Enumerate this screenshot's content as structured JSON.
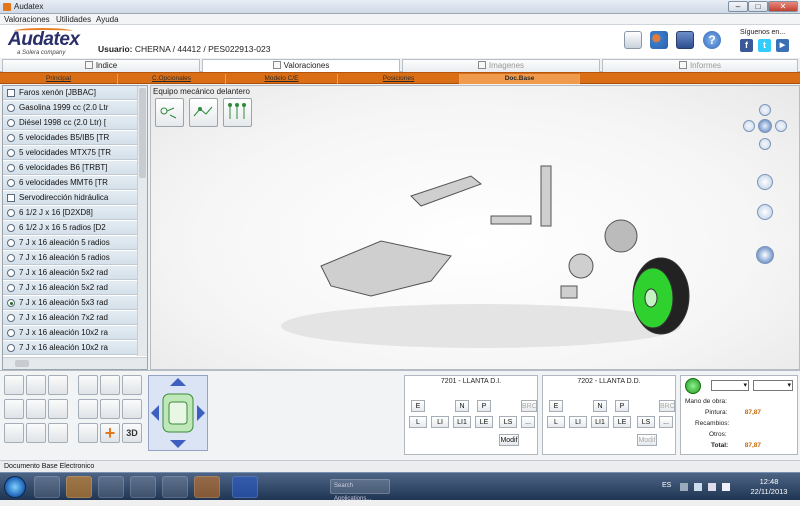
{
  "window": {
    "title": "Audatex",
    "controls": {
      "minimize": "–",
      "maximize": "□",
      "close": "✕"
    }
  },
  "menu": [
    "Valoraciones",
    "Utilidades",
    "Ayuda"
  ],
  "header": {
    "logo": "Audatex",
    "tagline": "a Solera company",
    "user_label": "Usuario:",
    "user_value": "CHERNA / 44412 / PES022913-023",
    "follow_label": "Síguenos en...",
    "icons": [
      "car-tool-icon",
      "users-icon",
      "monitor-icon",
      "help-icon"
    ],
    "social": [
      {
        "name": "facebook",
        "glyph": "f",
        "color": "#3b5998"
      },
      {
        "name": "twitter",
        "glyph": "t",
        "color": "#33ccff"
      },
      {
        "name": "youtube",
        "glyph": "▶",
        "color": "#3b6fb6"
      }
    ]
  },
  "tabs": [
    {
      "label": "Indice",
      "state": "normal"
    },
    {
      "label": "Valoraciones",
      "state": "active"
    },
    {
      "label": "Imagenes",
      "state": "disabled"
    },
    {
      "label": "Informes",
      "state": "disabled"
    }
  ],
  "subtabs": [
    {
      "label": "Principal",
      "active": false
    },
    {
      "label": "C.Opcionales",
      "active": false
    },
    {
      "label": "Modelo C/E",
      "active": false
    },
    {
      "label": "Posiciones",
      "active": false
    },
    {
      "label": "Doc.Base",
      "active": true
    }
  ],
  "options_list": [
    {
      "type": "checkbox",
      "checked": false,
      "label": "Faros xenón  [JBBAC]"
    },
    {
      "type": "radio",
      "checked": false,
      "label": "Gasolina 1999 cc (2.0 Ltr"
    },
    {
      "type": "radio",
      "checked": false,
      "label": "Diésel 1998 cc (2.0 Ltr)  ["
    },
    {
      "type": "radio",
      "checked": false,
      "label": "5 velocidades B5/IB5  [TR"
    },
    {
      "type": "radio",
      "checked": false,
      "label": "5 velocidades MTX75  [TR"
    },
    {
      "type": "radio",
      "checked": false,
      "label": "6 velocidades B6  [TRBT]"
    },
    {
      "type": "radio",
      "checked": false,
      "label": "6 velocidades MMT6  [TR"
    },
    {
      "type": "checkbox",
      "checked": false,
      "label": "Servodirección hidráulica"
    },
    {
      "type": "radio",
      "checked": false,
      "label": "6 1/2 J x 16  [D2XD8]"
    },
    {
      "type": "radio",
      "checked": false,
      "label": "6 1/2 J x 16 5 radios  [D2"
    },
    {
      "type": "radio",
      "checked": false,
      "label": "7 J x 16 aleación 5 radios"
    },
    {
      "type": "radio",
      "checked": false,
      "label": "7 J x 16 aleación 5 radios"
    },
    {
      "type": "radio",
      "checked": false,
      "label": "7 J x 16 aleación 5x2 rad"
    },
    {
      "type": "radio",
      "checked": false,
      "label": "7 J x 16 aleación 5x2 rad"
    },
    {
      "type": "radio",
      "checked": true,
      "label": "7 J x 16 aleación 5x3 rad"
    },
    {
      "type": "radio",
      "checked": false,
      "label": "7 J x 16 aleación 7x2 rad"
    },
    {
      "type": "radio",
      "checked": false,
      "label": "7 J x 16 aleación 10x2 ra"
    },
    {
      "type": "radio",
      "checked": false,
      "label": "7 J x 16 aleación 10x2 ra"
    }
  ],
  "viewer": {
    "title": "Equipo mecánico delantero"
  },
  "ladders": [
    {
      "title": "7201 - LLANTA D.I.",
      "ops_row1": [
        "E",
        "N",
        "P",
        "BRC"
      ],
      "ops_row2": [
        "L",
        "LI",
        "LI1",
        "LE",
        "LS",
        "..."
      ],
      "modif": "Modif"
    },
    {
      "title": "7202 - LLANTA D.D.",
      "ops_row1": [
        "E",
        "N",
        "P",
        "BRC"
      ],
      "ops_row2": [
        "L",
        "LI",
        "LI1",
        "LE",
        "LS",
        "..."
      ],
      "modif": "Modif"
    }
  ],
  "costs": {
    "mano_obra": "Mano de obra:",
    "pintura_label": "Pintura:",
    "pintura_value": "87,87",
    "recambios_label": "Recambios:",
    "otros_label": "Otros:",
    "total_label": "Total:",
    "total_value": "87,87"
  },
  "status": {
    "text": "Documento Base Electronico"
  },
  "taskbar": {
    "time": "12:48",
    "date": "22/11/2013",
    "lang": "ES",
    "search_placeholder": "Search Applications..."
  }
}
